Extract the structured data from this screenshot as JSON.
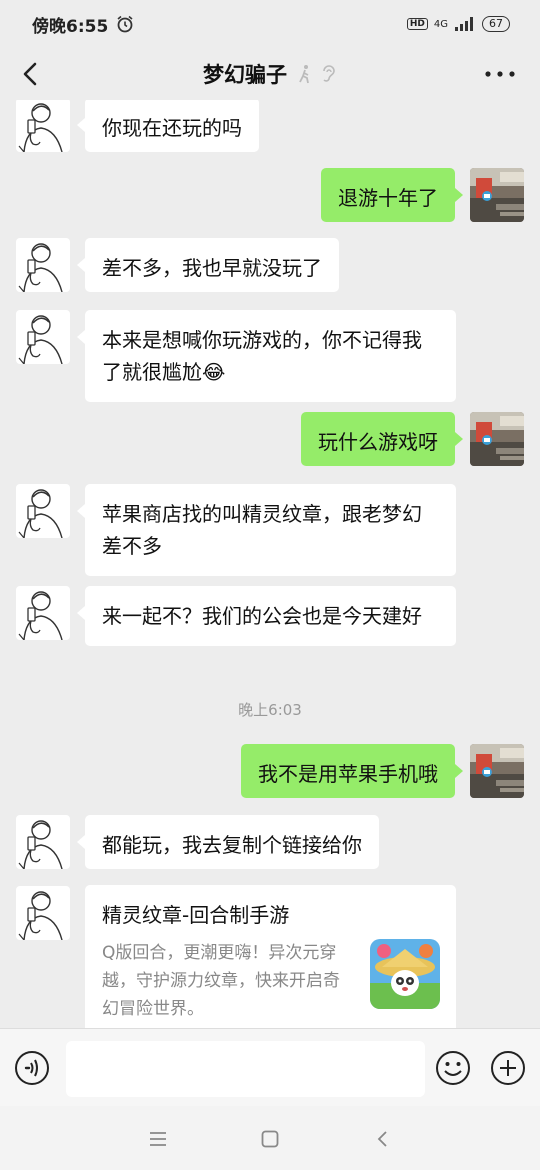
{
  "status_bar": {
    "time": "傍晚6:55",
    "hd": "HD",
    "network": "4G",
    "battery": "67"
  },
  "header": {
    "title": "梦幻骗子"
  },
  "messages": [
    {
      "side": "left",
      "text": "你现在还玩的吗"
    },
    {
      "side": "right",
      "text": "退游十年了"
    },
    {
      "side": "left",
      "text": "差不多，我也早就没玩了"
    },
    {
      "side": "left",
      "text": "本来是想喊你玩游戏的，你不记得我了就很尴尬😂"
    },
    {
      "side": "right",
      "text": "玩什么游戏呀"
    },
    {
      "side": "left",
      "text": "苹果商店找的叫精灵纹章，跟老梦幻差不多"
    },
    {
      "side": "left",
      "text": "来一起不？我们的公会也是今天建好"
    },
    {
      "timestamp": "晚上6:03"
    },
    {
      "side": "right",
      "text": "我不是用苹果手机哦"
    },
    {
      "side": "left",
      "text": "都能玩，我去复制个链接给你"
    }
  ],
  "link_card": {
    "title": "精灵纹章-回合制手游",
    "description": "Q版回合，更潮更嗨！异次元穿越，守护源力纹章，快来开启奇幻冒险世界。"
  },
  "input": {
    "placeholder": ""
  },
  "colors": {
    "background": "#ededed",
    "sent_bubble": "#95ec69",
    "received_bubble": "#ffffff"
  }
}
